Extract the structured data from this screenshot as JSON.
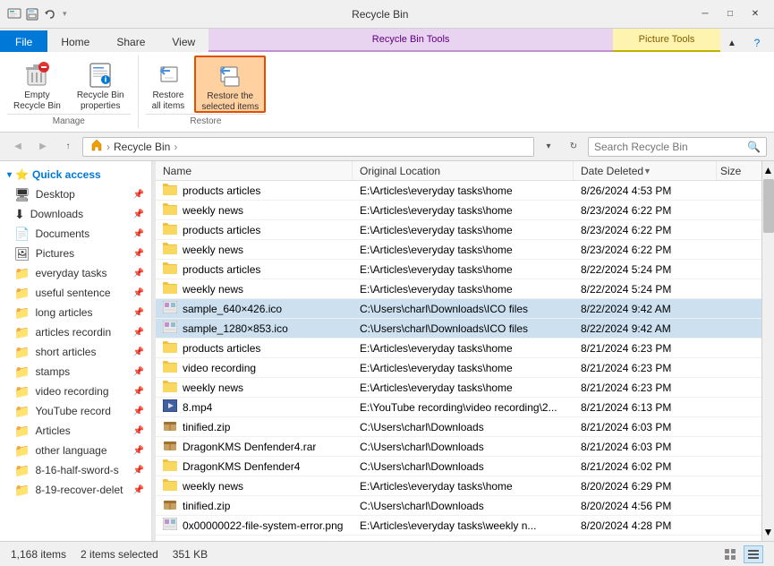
{
  "titleBar": {
    "title": "Recycle Bin",
    "icons": [
      "quick-access",
      "save",
      "undo"
    ],
    "controls": [
      "minimize",
      "maximize",
      "close"
    ]
  },
  "ribbon": {
    "tabs": [
      {
        "id": "file",
        "label": "File",
        "type": "file"
      },
      {
        "id": "home",
        "label": "Home",
        "type": "normal"
      },
      {
        "id": "share",
        "label": "Share",
        "type": "normal"
      },
      {
        "id": "view",
        "label": "View",
        "type": "normal"
      },
      {
        "id": "recycle-bin-tools",
        "label": "Recycle Bin Tools",
        "type": "manage-recycle"
      },
      {
        "id": "picture-tools",
        "label": "Picture Tools",
        "type": "manage-picture"
      }
    ],
    "activeTab": "Recycle Bin Tools",
    "groups": [
      {
        "label": "Manage",
        "buttons": [
          {
            "id": "empty",
            "icon": "🗑",
            "label": "Empty\nRecycle Bin",
            "selected": false
          },
          {
            "id": "properties",
            "icon": "📋",
            "label": "Recycle Bin\nproperties",
            "selected": false
          }
        ]
      },
      {
        "label": "Restore",
        "buttons": [
          {
            "id": "restore-all",
            "icon": "↩",
            "label": "Restore\nall items",
            "selected": false
          },
          {
            "id": "restore-selected",
            "icon": "↩",
            "label": "Restore the\nselected items",
            "selected": true
          }
        ]
      }
    ]
  },
  "addressBar": {
    "navBack": "←",
    "navForward": "→",
    "navUp": "↑",
    "recentLocations": "▾",
    "refresh": "↻",
    "path": "Recycle Bin",
    "searchPlaceholder": "Search Recycle Bin"
  },
  "sidebar": {
    "sections": [
      {
        "id": "quick-access",
        "label": "Quick access",
        "items": [
          {
            "id": "desktop",
            "label": "Desktop",
            "icon": "🖥",
            "pinned": true
          },
          {
            "id": "downloads",
            "label": "Downloads",
            "icon": "⬇",
            "pinned": true
          },
          {
            "id": "documents",
            "label": "Documents",
            "icon": "📄",
            "pinned": true
          },
          {
            "id": "pictures",
            "label": "Pictures",
            "icon": "🖼",
            "pinned": true
          },
          {
            "id": "everyday-tasks",
            "label": "everyday tasks",
            "icon": "📁",
            "pinned": true
          },
          {
            "id": "useful-sentence",
            "label": "useful sentence",
            "icon": "📁",
            "pinned": true
          },
          {
            "id": "long-articles",
            "label": "long articles",
            "icon": "📁",
            "pinned": true
          },
          {
            "id": "articles-recording",
            "label": "articles recordin",
            "icon": "📁",
            "pinned": true
          },
          {
            "id": "short-articles",
            "label": "short articles",
            "icon": "📁",
            "pinned": true
          },
          {
            "id": "stamps",
            "label": "stamps",
            "icon": "📁",
            "pinned": true
          },
          {
            "id": "video-recording",
            "label": "video recording",
            "icon": "📁",
            "pinned": true
          },
          {
            "id": "youtube-record",
            "label": "YouTube record",
            "icon": "📁",
            "pinned": true
          },
          {
            "id": "articles",
            "label": "Articles",
            "icon": "📁",
            "pinned": true
          },
          {
            "id": "other-language",
            "label": "other language",
            "icon": "📁",
            "pinned": true
          },
          {
            "id": "8-16-half-sword",
            "label": "8-16-half-sword-s",
            "icon": "📁",
            "pinned": true
          },
          {
            "id": "8-19-recover-delet",
            "label": "8-19-recover-delet",
            "icon": "📁",
            "pinned": true
          }
        ]
      }
    ]
  },
  "fileList": {
    "columns": [
      {
        "id": "name",
        "label": "Name"
      },
      {
        "id": "location",
        "label": "Original Location"
      },
      {
        "id": "date",
        "label": "Date Deleted",
        "sorted": true,
        "sortDir": "desc"
      },
      {
        "id": "size",
        "label": "Size"
      }
    ],
    "rows": [
      {
        "id": 1,
        "name": "products articles",
        "icon": "📁",
        "location": "E:\\Articles\\everyday tasks\\home",
        "date": "8/26/2024 4:53 PM",
        "size": "",
        "selected": false
      },
      {
        "id": 2,
        "name": "weekly news",
        "icon": "📁",
        "location": "E:\\Articles\\everyday tasks\\home",
        "date": "8/23/2024 6:22 PM",
        "size": "",
        "selected": false
      },
      {
        "id": 3,
        "name": "products articles",
        "icon": "📁",
        "location": "E:\\Articles\\everyday tasks\\home",
        "date": "8/23/2024 6:22 PM",
        "size": "",
        "selected": false
      },
      {
        "id": 4,
        "name": "weekly news",
        "icon": "📁",
        "location": "E:\\Articles\\everyday tasks\\home",
        "date": "8/23/2024 6:22 PM",
        "size": "",
        "selected": false
      },
      {
        "id": 5,
        "name": "products articles",
        "icon": "📁",
        "location": "E:\\Articles\\everyday tasks\\home",
        "date": "8/22/2024 5:24 PM",
        "size": "",
        "selected": false
      },
      {
        "id": 6,
        "name": "weekly news",
        "icon": "📁",
        "location": "E:\\Articles\\everyday tasks\\home",
        "date": "8/22/2024 5:24 PM",
        "size": "",
        "selected": false
      },
      {
        "id": 7,
        "name": "sample_640×426.ico",
        "icon": "🖼",
        "location": "C:\\Users\\charl\\Downloads\\ICO files",
        "date": "8/22/2024 9:42 AM",
        "size": "",
        "selected": true
      },
      {
        "id": 8,
        "name": "sample_1280×853.ico",
        "icon": "🖼",
        "location": "C:\\Users\\charl\\Downloads\\ICO files",
        "date": "8/22/2024 9:42 AM",
        "size": "",
        "selected": true
      },
      {
        "id": 9,
        "name": "products articles",
        "icon": "📁",
        "location": "E:\\Articles\\everyday tasks\\home",
        "date": "8/21/2024 6:23 PM",
        "size": "",
        "selected": false
      },
      {
        "id": 10,
        "name": "video recording",
        "icon": "📁",
        "location": "E:\\Articles\\everyday tasks\\home",
        "date": "8/21/2024 6:23 PM",
        "size": "",
        "selected": false
      },
      {
        "id": 11,
        "name": "weekly news",
        "icon": "📁",
        "location": "E:\\Articles\\everyday tasks\\home",
        "date": "8/21/2024 6:23 PM",
        "size": "",
        "selected": false
      },
      {
        "id": 12,
        "name": "8.mp4",
        "icon": "🎬",
        "location": "E:\\YouTube recording\\video recording\\2...",
        "date": "8/21/2024 6:13 PM",
        "size": "",
        "selected": false
      },
      {
        "id": 13,
        "name": "tinified.zip",
        "icon": "📦",
        "location": "C:\\Users\\charl\\Downloads",
        "date": "8/21/2024 6:03 PM",
        "size": "",
        "selected": false
      },
      {
        "id": 14,
        "name": "DragonKMS Denfender4.rar",
        "icon": "📦",
        "location": "C:\\Users\\charl\\Downloads",
        "date": "8/21/2024 6:03 PM",
        "size": "",
        "selected": false
      },
      {
        "id": 15,
        "name": "DragonKMS Denfender4",
        "icon": "📁",
        "location": "C:\\Users\\charl\\Downloads",
        "date": "8/21/2024 6:02 PM",
        "size": "",
        "selected": false
      },
      {
        "id": 16,
        "name": "weekly news",
        "icon": "📁",
        "location": "E:\\Articles\\everyday tasks\\home",
        "date": "8/20/2024 6:29 PM",
        "size": "",
        "selected": false
      },
      {
        "id": 17,
        "name": "tinified.zip",
        "icon": "📦",
        "location": "C:\\Users\\charl\\Downloads",
        "date": "8/20/2024 4:56 PM",
        "size": "",
        "selected": false
      },
      {
        "id": 18,
        "name": "0x00000022-file-system-error.png",
        "icon": "🖼",
        "location": "E:\\Articles\\everyday tasks\\weekly n...",
        "date": "8/20/2024 4:28 PM",
        "size": "",
        "selected": false
      }
    ]
  },
  "statusBar": {
    "itemCount": "1,168 items",
    "selectedCount": "2 items selected",
    "selectedSize": "351 KB",
    "viewDetails": "details-icon",
    "viewLarge": "large-icon"
  }
}
